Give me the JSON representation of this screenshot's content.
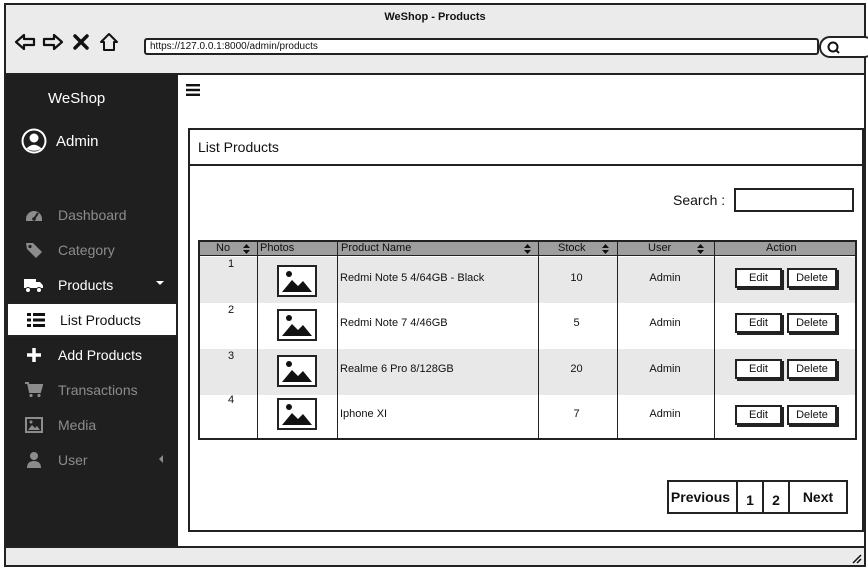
{
  "window": {
    "title": "WeShop - Products",
    "url": "https://127.0.0.1:8000/admin/products"
  },
  "sidebar": {
    "brand": "WeShop",
    "user": "Admin",
    "items": [
      {
        "label": "Dashboard",
        "icon": "dashboard-icon"
      },
      {
        "label": "Category",
        "icon": "tag-icon"
      },
      {
        "label": "Products",
        "icon": "truck-icon"
      },
      {
        "label": "List Products",
        "icon": "list-icon"
      },
      {
        "label": "Add Products",
        "icon": "plus-icon"
      },
      {
        "label": "Transactions",
        "icon": "cart-icon"
      },
      {
        "label": "Media",
        "icon": "image-icon"
      },
      {
        "label": "User",
        "icon": "user-icon"
      }
    ]
  },
  "main": {
    "panel_title": "List Products",
    "search_label": "Search :",
    "search_value": "",
    "table": {
      "columns": [
        "No",
        "Photos",
        "Product Name",
        "Stock",
        "User",
        "Action"
      ],
      "rows": [
        {
          "no": "1",
          "name": "Redmi Note 5 4/64GB - Black",
          "stock": "10",
          "user": "Admin"
        },
        {
          "no": "2",
          "name": "Redmi Note 7 4/46GB",
          "stock": "5",
          "user": "Admin"
        },
        {
          "no": "3",
          "name": "Realme 6 Pro 8/128GB",
          "stock": "20",
          "user": "Admin"
        },
        {
          "no": "4",
          "name": "Iphone XI",
          "stock": "7",
          "user": "Admin"
        }
      ],
      "edit_label": "Edit",
      "delete_label": "Delete"
    },
    "pagination": {
      "previous": "Previous",
      "pages": [
        "1",
        "2"
      ],
      "next": "Next"
    }
  },
  "colors": {
    "sidebar_bg": "#1f1f1f",
    "header_bg": "#9e9e9e",
    "row_shade": "#e8e8e8"
  }
}
